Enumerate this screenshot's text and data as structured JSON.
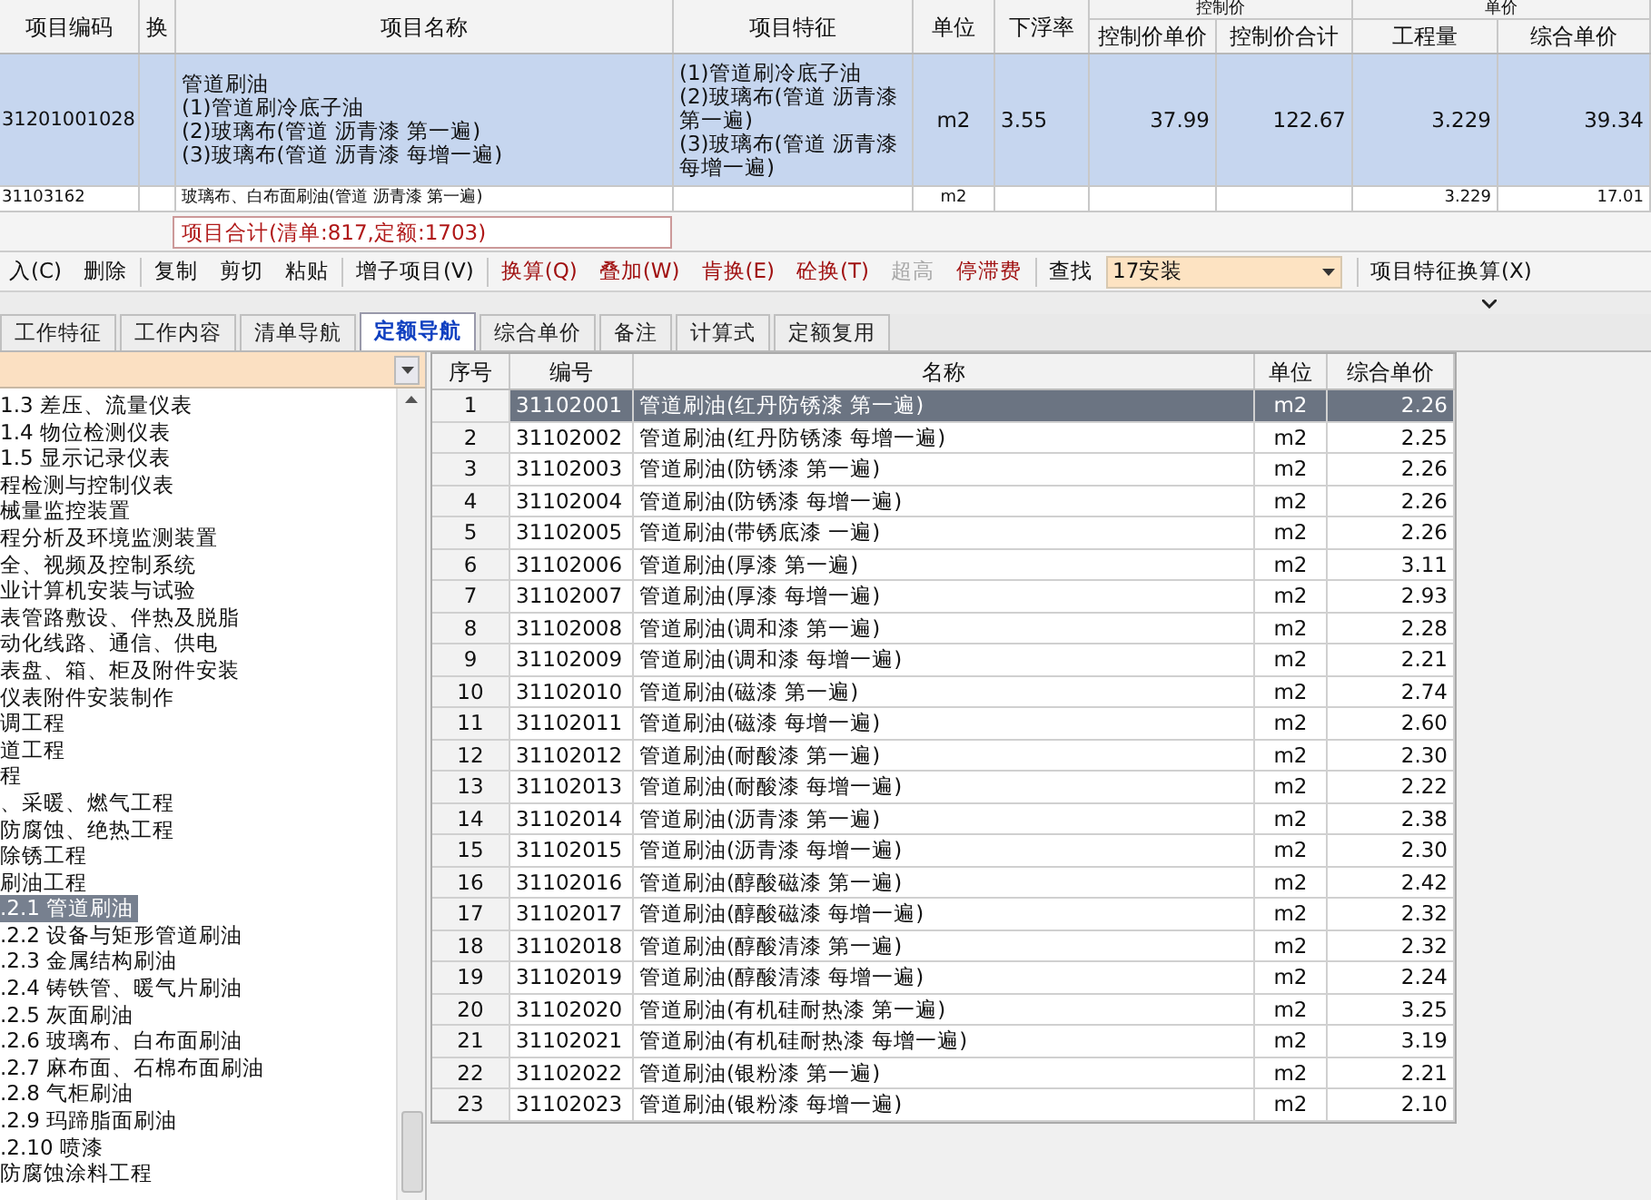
{
  "bill_table": {
    "columns": [
      "项目编码",
      "换",
      "项目名称",
      "项目特征",
      "单位",
      "下浮率",
      "控制价单价",
      "控制价合计",
      "工程量",
      "综合单价"
    ],
    "group_headers": [
      "控制价",
      "单价"
    ],
    "rows": [
      {
        "selected": true,
        "cells": [
          "31201001028",
          "",
          "管道刷油\n(1)管道刷冷底子油\n(2)玻璃布(管道 沥青漆 第一遍)\n(3)玻璃布(管道 沥青漆 每增一遍)",
          "(1)管道刷冷底子油\n(2)玻璃布(管道 沥青漆第一遍)\n(3)玻璃布(管道 沥青漆每增一遍)",
          "m2",
          "3.55",
          "37.99",
          "122.67",
          "3.229",
          "39.34"
        ]
      },
      {
        "selected": false,
        "cells": [
          "31103162",
          "",
          "玻璃布、白布面刷油(管道 沥青漆 第一遍)",
          "",
          "m2",
          "",
          "",
          "",
          "3.229",
          "17.01"
        ]
      }
    ]
  },
  "summary": "项目合计(清单:817,定额:1703)",
  "toolbar": [
    {
      "label": "入(C)",
      "disabled": false
    },
    {
      "label": "删除",
      "disabled": false,
      "separator": true
    },
    {
      "label": "复制",
      "disabled": false
    },
    {
      "label": "剪切",
      "disabled": false
    },
    {
      "label": "粘贴",
      "disabled": false,
      "separator": true
    },
    {
      "label": "增子项目(V)",
      "disabled": false,
      "separator": true
    },
    {
      "label": "换算(Q)",
      "disabled": false,
      "color": "#a01010"
    },
    {
      "label": "叠加(W)",
      "disabled": false,
      "color": "#a01010"
    },
    {
      "label": "肯换(E)",
      "disabled": false,
      "color": "#a01010"
    },
    {
      "label": "砼换(T)",
      "disabled": false,
      "color": "#a01010"
    },
    {
      "label": "超高",
      "disabled": true
    },
    {
      "label": "停滞费",
      "disabled": false,
      "color": "#a01010",
      "separator": true
    },
    {
      "label": "查找",
      "disabled": false
    }
  ],
  "search_select": {
    "value": "17安装"
  },
  "toolbar_end": "项目特征换算(X)",
  "tabs": [
    {
      "label": "工作特征",
      "selected": false
    },
    {
      "label": "工作内容",
      "selected": false
    },
    {
      "label": "清单导航",
      "selected": false
    },
    {
      "label": "定额导航",
      "selected": true
    },
    {
      "label": "综合单价",
      "selected": false
    },
    {
      "label": "备注",
      "selected": false
    },
    {
      "label": "计算式",
      "selected": false
    },
    {
      "label": "定额复用",
      "selected": false
    }
  ],
  "tree": {
    "items": [
      {
        "label": "1.3 差压、流量仪表",
        "selected": false
      },
      {
        "label": "1.4 物位检测仪表",
        "selected": false
      },
      {
        "label": "1.5 显示记录仪表",
        "selected": false
      },
      {
        "label": "程检测与控制仪表",
        "selected": false
      },
      {
        "label": "械量监控装置",
        "selected": false
      },
      {
        "label": "程分析及环境监测装置",
        "selected": false
      },
      {
        "label": "全、视频及控制系统",
        "selected": false
      },
      {
        "label": "业计算机安装与试验",
        "selected": false
      },
      {
        "label": "表管路敷设、伴热及脱脂",
        "selected": false
      },
      {
        "label": "动化线路、通信、供电",
        "selected": false
      },
      {
        "label": "表盘、箱、柜及附件安装",
        "selected": false
      },
      {
        "label": "仪表附件安装制作",
        "selected": false
      },
      {
        "label": "调工程",
        "selected": false
      },
      {
        "label": "道工程",
        "selected": false
      },
      {
        "label": "程",
        "selected": false
      },
      {
        "label": "、采暖、燃气工程",
        "selected": false
      },
      {
        "label": "防腐蚀、绝热工程",
        "selected": false
      },
      {
        "label": "除锈工程",
        "selected": false
      },
      {
        "label": "刷油工程",
        "selected": false
      },
      {
        "label": ".2.1 管道刷油",
        "selected": true
      },
      {
        "label": ".2.2 设备与矩形管道刷油",
        "selected": false
      },
      {
        "label": ".2.3 金属结构刷油",
        "selected": false
      },
      {
        "label": ".2.4 铸铁管、暖气片刷油",
        "selected": false
      },
      {
        "label": ".2.5 灰面刷油",
        "selected": false
      },
      {
        "label": ".2.6 玻璃布、白布面刷油",
        "selected": false
      },
      {
        "label": ".2.7 麻布面、石棉布面刷油",
        "selected": false
      },
      {
        "label": ".2.8 气柜刷油",
        "selected": false
      },
      {
        "label": ".2.9 玛蹄脂面刷油",
        "selected": false
      },
      {
        "label": ".2.10 喷漆",
        "selected": false
      },
      {
        "label": "防腐蚀涂料工程",
        "selected": false
      }
    ]
  },
  "quota_table": {
    "columns": [
      "序号",
      "编号",
      "名称",
      "单位",
      "综合单价"
    ],
    "rows": [
      {
        "selected": true,
        "cells": [
          "1",
          "31102001",
          "管道刷油(红丹防锈漆 第一遍)",
          "m2",
          "2.26"
        ]
      },
      {
        "selected": false,
        "cells": [
          "2",
          "31102002",
          "管道刷油(红丹防锈漆 每增一遍)",
          "m2",
          "2.25"
        ]
      },
      {
        "selected": false,
        "cells": [
          "3",
          "31102003",
          "管道刷油(防锈漆 第一遍)",
          "m2",
          "2.26"
        ]
      },
      {
        "selected": false,
        "cells": [
          "4",
          "31102004",
          "管道刷油(防锈漆 每增一遍)",
          "m2",
          "2.26"
        ]
      },
      {
        "selected": false,
        "cells": [
          "5",
          "31102005",
          "管道刷油(带锈底漆 一遍)",
          "m2",
          "2.26"
        ]
      },
      {
        "selected": false,
        "cells": [
          "6",
          "31102006",
          "管道刷油(厚漆 第一遍)",
          "m2",
          "3.11"
        ]
      },
      {
        "selected": false,
        "cells": [
          "7",
          "31102007",
          "管道刷油(厚漆 每增一遍)",
          "m2",
          "2.93"
        ]
      },
      {
        "selected": false,
        "cells": [
          "8",
          "31102008",
          "管道刷油(调和漆 第一遍)",
          "m2",
          "2.28"
        ]
      },
      {
        "selected": false,
        "cells": [
          "9",
          "31102009",
          "管道刷油(调和漆 每增一遍)",
          "m2",
          "2.21"
        ]
      },
      {
        "selected": false,
        "cells": [
          "10",
          "31102010",
          "管道刷油(磁漆 第一遍)",
          "m2",
          "2.74"
        ]
      },
      {
        "selected": false,
        "cells": [
          "11",
          "31102011",
          "管道刷油(磁漆 每增一遍)",
          "m2",
          "2.60"
        ]
      },
      {
        "selected": false,
        "cells": [
          "12",
          "31102012",
          "管道刷油(耐酸漆 第一遍)",
          "m2",
          "2.30"
        ]
      },
      {
        "selected": false,
        "cells": [
          "13",
          "31102013",
          "管道刷油(耐酸漆 每增一遍)",
          "m2",
          "2.22"
        ]
      },
      {
        "selected": false,
        "cells": [
          "14",
          "31102014",
          "管道刷油(沥青漆 第一遍)",
          "m2",
          "2.38"
        ]
      },
      {
        "selected": false,
        "cells": [
          "15",
          "31102015",
          "管道刷油(沥青漆 每增一遍)",
          "m2",
          "2.30"
        ]
      },
      {
        "selected": false,
        "cells": [
          "16",
          "31102016",
          "管道刷油(醇酸磁漆 第一遍)",
          "m2",
          "2.42"
        ]
      },
      {
        "selected": false,
        "cells": [
          "17",
          "31102017",
          "管道刷油(醇酸磁漆 每增一遍)",
          "m2",
          "2.32"
        ]
      },
      {
        "selected": false,
        "cells": [
          "18",
          "31102018",
          "管道刷油(醇酸清漆 第一遍)",
          "m2",
          "2.32"
        ]
      },
      {
        "selected": false,
        "cells": [
          "19",
          "31102019",
          "管道刷油(醇酸清漆 每增一遍)",
          "m2",
          "2.24"
        ]
      },
      {
        "selected": false,
        "cells": [
          "20",
          "31102020",
          "管道刷油(有机硅耐热漆 第一遍)",
          "m2",
          "3.25"
        ]
      },
      {
        "selected": false,
        "cells": [
          "21",
          "31102021",
          "管道刷油(有机硅耐热漆 每增一遍)",
          "m2",
          "3.19"
        ]
      },
      {
        "selected": false,
        "cells": [
          "22",
          "31102022",
          "管道刷油(银粉漆 第一遍)",
          "m2",
          "2.21"
        ]
      },
      {
        "selected": false,
        "cells": [
          "23",
          "31102023",
          "管道刷油(银粉漆 每增一遍)",
          "m2",
          "2.10"
        ]
      }
    ]
  }
}
